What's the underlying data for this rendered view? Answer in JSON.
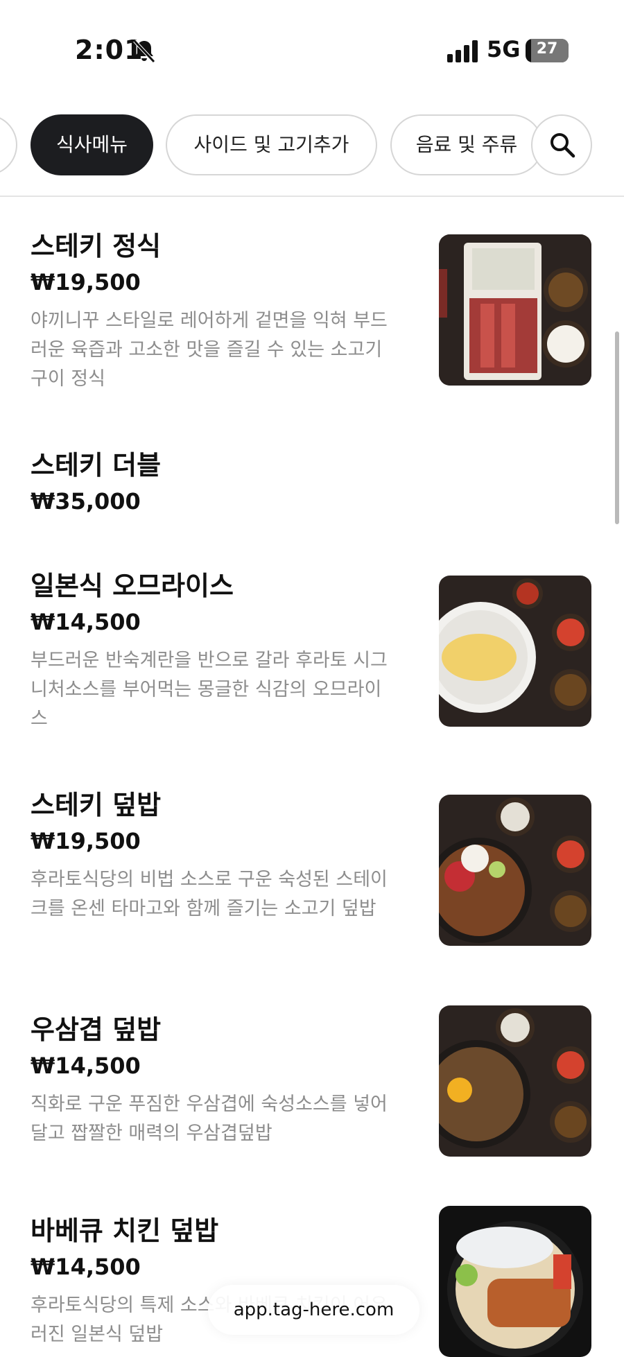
{
  "status_bar": {
    "time": "2:01",
    "network": "5G",
    "battery": "27"
  },
  "tabs": [
    {
      "label": "식사메뉴",
      "active": true
    },
    {
      "label": "사이드 및 고기추가",
      "active": false
    },
    {
      "label": "음료 및 주류",
      "active": false
    }
  ],
  "menu": [
    {
      "name": "스테키 정식",
      "price": "₩19,500",
      "desc": "야끼니꾸 스타일로 레어하게 겉면을 익혀 부드러운 육즙과 고소한 맛을 즐길 수 있는 소고기 구이 정식",
      "image": "steak-set-photo"
    },
    {
      "name": "스테키 더블",
      "price": "₩35,000",
      "desc": "",
      "image": ""
    },
    {
      "name": "일본식 오므라이스",
      "price": "₩14,500",
      "desc": "부드러운 반숙계란을 반으로 갈라 후라토 시그니처소스를 부어먹는 몽글한 식감의 오므라이스",
      "image": "omurice-photo"
    },
    {
      "name": "스테키 덮밥",
      "price": "₩19,500",
      "desc": "후라토식당의 비법 소스로 구운 숙성된 스테이크를 온센 타마고와 함께 즐기는 소고기 덮밥",
      "image": "steak-bowl-photo"
    },
    {
      "name": "우삼겹 덮밥",
      "price": "₩14,500",
      "desc": "직화로 구운 푸짐한 우삼겹에 숙성소스를 넣어 달고 짭짤한 매력의 우삼겹덮밥",
      "image": "beef-brisket-bowl-photo"
    },
    {
      "name": "바베큐 치킨 덮밥",
      "price": "₩14,500",
      "desc": "후라토식당의 특제 소스와 바베큐 치킨이 어우러진 일본식 덮밥",
      "image": "bbq-chicken-bowl-photo"
    }
  ],
  "url_bar": {
    "host": "app.tag-here.com"
  },
  "colors": {
    "active_tab": "#1c1d20",
    "desc_text": "#8d8d8d",
    "border": "#d6d6d6"
  }
}
